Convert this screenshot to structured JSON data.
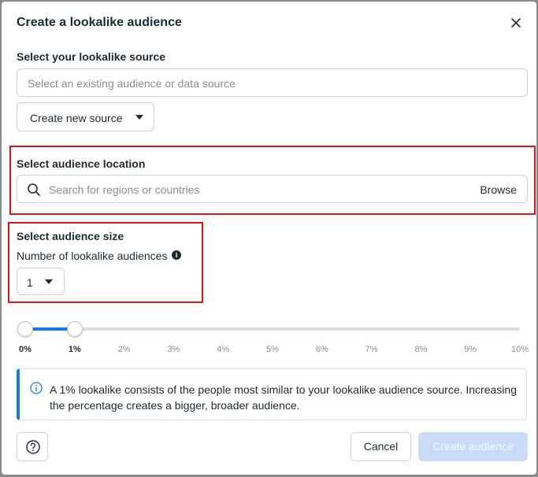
{
  "dialog": {
    "title": "Create a lookalike audience"
  },
  "source": {
    "label": "Select your lookalike source",
    "placeholder": "Select an existing audience or data source",
    "create_button": "Create new source"
  },
  "location": {
    "label": "Select audience location",
    "placeholder": "Search for regions or countries",
    "browse": "Browse"
  },
  "size": {
    "label": "Select audience size",
    "count_label": "Number of lookalike audiences",
    "count_value": "1",
    "slider_range_percent": [
      0,
      1
    ],
    "ticks": [
      "0%",
      "1%",
      "2%",
      "3%",
      "4%",
      "5%",
      "6%",
      "7%",
      "8%",
      "9%",
      "10%"
    ]
  },
  "info": {
    "text": "A 1% lookalike consists of the people most similar to your lookalike audience source. Increasing the percentage creates a bigger, broader audience."
  },
  "footer": {
    "cancel": "Cancel",
    "create": "Create audience"
  },
  "colors": {
    "accent": "#1877f2",
    "highlight": "#e0131a",
    "disabled_button": "#c8dcf7"
  },
  "icons": {
    "close": "close-icon",
    "search": "search-icon",
    "info": "info-icon",
    "help": "help-icon",
    "caret": "caret-down-icon"
  }
}
